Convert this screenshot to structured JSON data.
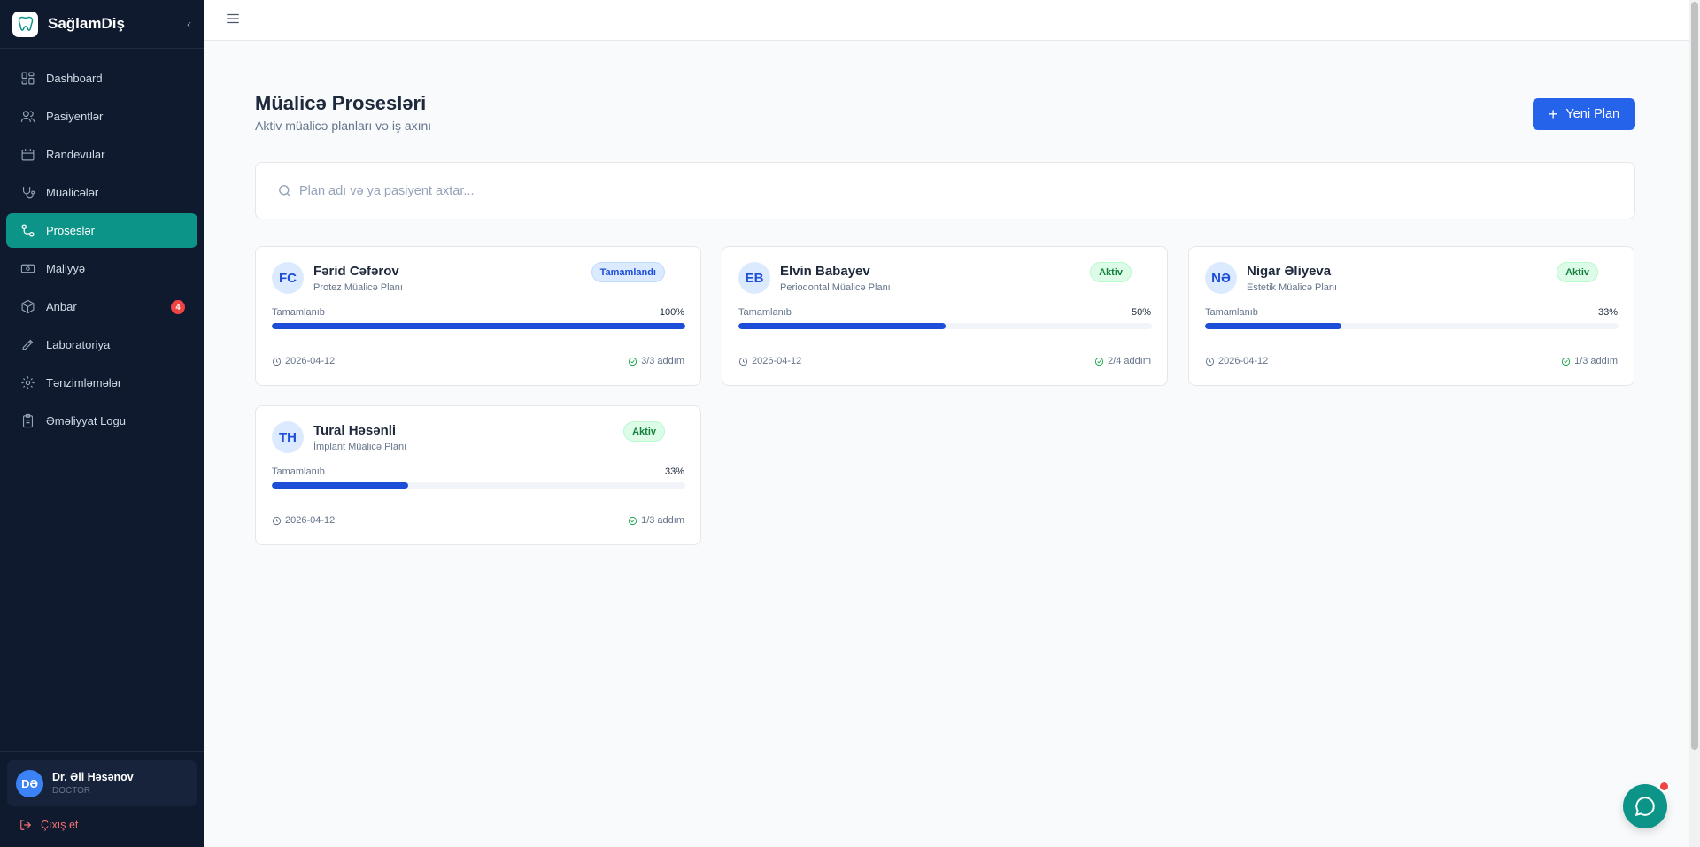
{
  "brand": {
    "name": "SağlamDiş",
    "logo_icon": "tooth-icon",
    "collapse_icon": "chevron-left-icon"
  },
  "nav": [
    {
      "label": "Dashboard",
      "icon": "dashboard-icon",
      "active": false
    },
    {
      "label": "Pasiyentlər",
      "icon": "users-icon",
      "active": false
    },
    {
      "label": "Randevular",
      "icon": "calendar-icon",
      "active": false
    },
    {
      "label": "Müalicələr",
      "icon": "stethoscope-icon",
      "active": false
    },
    {
      "label": "Proseslər",
      "icon": "workflow-icon",
      "active": true
    },
    {
      "label": "Maliyyə",
      "icon": "banknote-icon",
      "active": false
    },
    {
      "label": "Anbar",
      "icon": "package-icon",
      "active": false,
      "badge": "4"
    },
    {
      "label": "Laboratoriya",
      "icon": "pen-icon",
      "active": false
    },
    {
      "label": "Tənzimləmələr",
      "icon": "gear-icon",
      "active": false
    },
    {
      "label": "Əməliyyat Logu",
      "icon": "clipboard-icon",
      "active": false
    }
  ],
  "user": {
    "initials": "DƏ",
    "name": "Dr. Əli Həsənov",
    "role": "DOCTOR"
  },
  "logout": {
    "label": "Çıxış et"
  },
  "page": {
    "title": "Müalicə Prosesləri",
    "subtitle": "Aktiv müalicə planları və iş axını",
    "new_button": "Yeni Plan"
  },
  "search": {
    "placeholder": "Plan adı və ya pasiyent axtar..."
  },
  "cards": [
    {
      "initials": "FC",
      "name": "Fərid Cəfərov",
      "plan": "Protez Müalicə Planı",
      "status": "Tamamlandı",
      "status_type": "done",
      "progress_label": "Tamamlanıb",
      "progress_text": "100%",
      "progress": 100,
      "date": "2026-04-12",
      "steps": "3/3 addım"
    },
    {
      "initials": "EB",
      "name": "Elvin Babayev",
      "plan": "Periodontal Müalicə Planı",
      "status": "Aktiv",
      "status_type": "active",
      "progress_label": "Tamamlanıb",
      "progress_text": "50%",
      "progress": 50,
      "date": "2026-04-12",
      "steps": "2/4 addım"
    },
    {
      "initials": "NƏ",
      "name": "Nigar Əliyeva",
      "plan": "Estetik Müalicə Planı",
      "status": "Aktiv",
      "status_type": "active",
      "progress_label": "Tamamlanıb",
      "progress_text": "33%",
      "progress": 33,
      "date": "2026-04-12",
      "steps": "1/3 addım"
    },
    {
      "initials": "TH",
      "name": "Tural Həsənli",
      "plan": "İmplant Müalicə Planı",
      "status": "Aktiv",
      "status_type": "active",
      "progress_label": "Tamamlanıb",
      "progress_text": "33%",
      "progress": 33,
      "date": "2026-04-12",
      "steps": "1/3 addım"
    }
  ],
  "colors": {
    "sidebar_bg": "#0f1a2e",
    "accent": "#0d9488",
    "primary": "#2563eb",
    "badge": "#ef4444"
  }
}
